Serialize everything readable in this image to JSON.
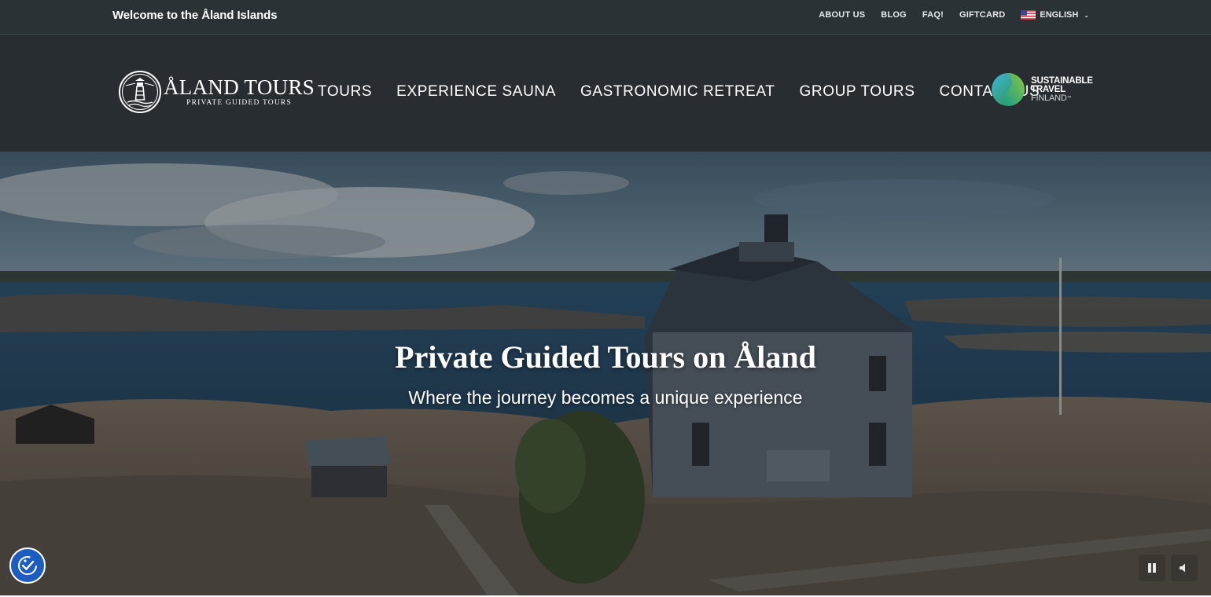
{
  "topbar": {
    "welcome": "Welcome to the Åland Islands",
    "links": [
      "ABOUT US",
      "BLOG",
      "FAQ!",
      "GIFTCARD"
    ],
    "language": "ENGLISH",
    "flag_icon": "us-flag-icon"
  },
  "header": {
    "logo_title": "ÅLAND TOURS",
    "logo_subtitle": "PRIVATE GUIDED TOURS",
    "logo_icon": "lighthouse-icon",
    "nav": [
      "TOURS",
      "EXPERIENCE SAUNA",
      "GASTRONOMIC RETREAT",
      "GROUP TOURS",
      "CONTACT US"
    ],
    "badge_lines": [
      "SUSTAINABLE",
      "TRAVEL",
      "FINLAND"
    ],
    "badge_mark": "™"
  },
  "hero": {
    "title": "Private Guided Tours on Åland",
    "subtitle": "Where the journey becomes a unique experience"
  },
  "controls": {
    "accessibility_icon": "accessibility-check-icon",
    "pause_icon": "pause-icon",
    "mute_icon": "speaker-icon"
  },
  "colors": {
    "topbar_bg": "#2b3236",
    "header_bg": "#272d31",
    "accessibility_blue": "#1d5cc0",
    "text": "#ffffff"
  }
}
